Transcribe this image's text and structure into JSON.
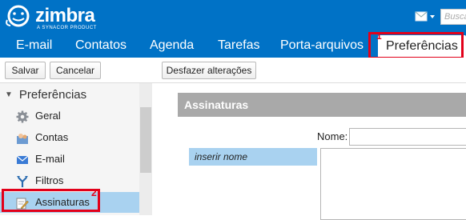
{
  "header": {
    "logo_text": "zimbra",
    "logo_subtext": "A SYNACOR PRODUCT",
    "search_placeholder": "Busca"
  },
  "tabs": [
    {
      "label": "E-mail"
    },
    {
      "label": "Contatos"
    },
    {
      "label": "Agenda"
    },
    {
      "label": "Tarefas"
    },
    {
      "label": "Porta-arquivos"
    },
    {
      "label": "Preferências",
      "active": true
    }
  ],
  "toolbar": {
    "save_label": "Salvar",
    "cancel_label": "Cancelar",
    "undo_label": "Desfazer alterações"
  },
  "sidebar": {
    "heading": "Preferências",
    "items": [
      {
        "label": "Geral",
        "icon": "gear-icon"
      },
      {
        "label": "Contas",
        "icon": "accounts-icon"
      },
      {
        "label": "E-mail",
        "icon": "envelope-icon"
      },
      {
        "label": "Filtros",
        "icon": "filter-icon"
      },
      {
        "label": "Assinaturas",
        "icon": "signature-icon",
        "selected": true
      }
    ]
  },
  "main": {
    "section_title": "Assinaturas",
    "name_label": "Nome:",
    "signature_item": "inserir nome"
  },
  "annotations": {
    "marker_1": "1",
    "marker_2": "2",
    "color": "#e2001a"
  },
  "colors": {
    "brand_blue": "#0072c6",
    "selection_blue": "#a9d2f0",
    "panel_gray": "#a9a9a9"
  }
}
